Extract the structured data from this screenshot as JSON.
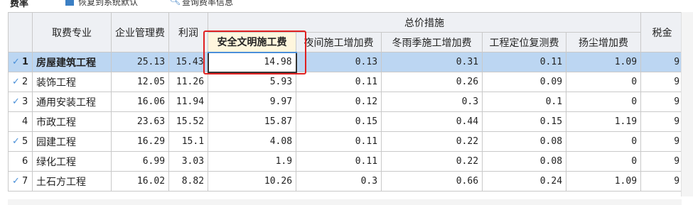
{
  "topbar": {
    "title": "费率",
    "option_label": "恢复到系统默认",
    "query_label": "查询费率信息"
  },
  "headers": {
    "category": "取费专业",
    "mgmt": "企业管理费",
    "profit": "利润",
    "group": "总价措施",
    "safety": "安全文明施工费",
    "night": "夜间施工增加费",
    "winter": "冬雨季施工增加费",
    "survey": "工程定位复测费",
    "dust": "扬尘增加费",
    "tax": "税金"
  },
  "rows": [
    {
      "no": "1",
      "checked": true,
      "name": "房屋建筑工程",
      "mgmt": "25.13",
      "profit": "15.43",
      "safety": "14.98",
      "night": "0.13",
      "winter": "0.31",
      "survey": "0.11",
      "dust": "1.09",
      "tax": "9"
    },
    {
      "no": "2",
      "checked": true,
      "name": "装饰工程",
      "mgmt": "12.05",
      "profit": "11.26",
      "safety": "5.93",
      "night": "0.11",
      "winter": "0.26",
      "survey": "0.09",
      "dust": "0",
      "tax": "9"
    },
    {
      "no": "3",
      "checked": true,
      "name": "通用安装工程",
      "mgmt": "16.06",
      "profit": "11.94",
      "safety": "9.97",
      "night": "0.12",
      "winter": "0.3",
      "survey": "0.1",
      "dust": "0",
      "tax": "9"
    },
    {
      "no": "4",
      "checked": false,
      "name": "市政工程",
      "mgmt": "23.63",
      "profit": "15.52",
      "safety": "15.87",
      "night": "0.15",
      "winter": "0.44",
      "survey": "0.15",
      "dust": "1.19",
      "tax": "9"
    },
    {
      "no": "5",
      "checked": true,
      "name": "园建工程",
      "mgmt": "16.29",
      "profit": "15.1",
      "safety": "4.08",
      "night": "0.11",
      "winter": "0.22",
      "survey": "0.08",
      "dust": "0",
      "tax": "9"
    },
    {
      "no": "6",
      "checked": false,
      "name": "绿化工程",
      "mgmt": "6.99",
      "profit": "3.03",
      "safety": "1.9",
      "night": "0.11",
      "winter": "0.22",
      "survey": "0.08",
      "dust": "0",
      "tax": "9"
    },
    {
      "no": "7",
      "checked": true,
      "name": "土石方工程",
      "mgmt": "16.02",
      "profit": "8.82",
      "safety": "10.26",
      "night": "0.3",
      "winter": "0.66",
      "survey": "0.24",
      "dust": "1.09",
      "tax": "9"
    }
  ],
  "selected_row": 0,
  "colors": {
    "selection": "#bcd6f2",
    "group_header": "#fff6dd",
    "highlight_box": "#e02020",
    "check": "#4a90d9"
  }
}
